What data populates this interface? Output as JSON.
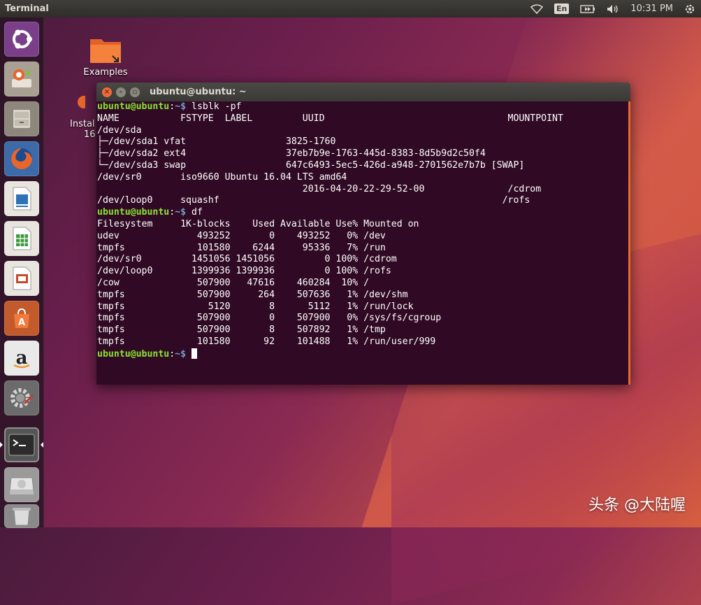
{
  "panel": {
    "app_title": "Terminal",
    "language": "En",
    "clock": "10:31 PM"
  },
  "launcher": {
    "items": [
      {
        "name": "dash-home",
        "icon": "ubuntu-logo-icon",
        "color": "#6f3a7c"
      },
      {
        "name": "install-ubuntu",
        "icon": "installer-icon",
        "color": "#c9c1b6"
      },
      {
        "name": "files",
        "icon": "file-cabinet-icon",
        "color": "#b8b1a5"
      },
      {
        "name": "firefox",
        "icon": "firefox-icon",
        "color": "#e8662c"
      },
      {
        "name": "writer",
        "icon": "writer-icon",
        "color": "#2e72b8"
      },
      {
        "name": "calc",
        "icon": "calc-icon",
        "color": "#3c9a3c"
      },
      {
        "name": "impress",
        "icon": "impress-icon",
        "color": "#c64a2a"
      },
      {
        "name": "software",
        "icon": "shopping-bag-icon",
        "color": "#e8672c"
      },
      {
        "name": "amazon",
        "icon": "amazon-icon",
        "color": "#e8e8e8"
      },
      {
        "name": "settings",
        "icon": "settings-gear-icon",
        "color": "#8a8a8a"
      },
      {
        "name": "terminal",
        "icon": "terminal-icon",
        "color": "#2a2a2a"
      },
      {
        "name": "disk",
        "icon": "disk-drive-icon",
        "color": "#c8c8c8"
      },
      {
        "name": "trash",
        "icon": "trash-icon",
        "color": "#b0b0b0"
      }
    ]
  },
  "desktop": {
    "examples_label": "Examples",
    "install_label_1": "Instal",
    "install_label_2": "16."
  },
  "terminal": {
    "title": "ubuntu@ubuntu: ~",
    "prompt_user": "ubuntu@ubuntu",
    "prompt_sep": ":",
    "prompt_path": "~$",
    "lines": [
      {
        "type": "prompt",
        "cmd": " lsblk -pf"
      },
      {
        "type": "out",
        "text": "NAME           FSTYPE  LABEL         UUID                                 MOUNTPOINT"
      },
      {
        "type": "out",
        "text": "/dev/sda"
      },
      {
        "type": "out",
        "text": "├─/dev/sda1 vfat                  3825-1760"
      },
      {
        "type": "out",
        "text": "├─/dev/sda2 ext4                  37eb7b9e-1763-445d-8383-8d5b9d2c50f4"
      },
      {
        "type": "out",
        "text": "└─/dev/sda3 swap                  647c6493-5ec5-426d-a948-2701562e7b7b [SWAP]"
      },
      {
        "type": "out",
        "text": "/dev/sr0       iso9660 Ubuntu 16.04 LTS amd64"
      },
      {
        "type": "out",
        "text": "                                     2016-04-20-22-29-52-00               /cdrom"
      },
      {
        "type": "out",
        "text": "/dev/loop0     squashf                                                   /rofs"
      },
      {
        "type": "prompt",
        "cmd": " df"
      },
      {
        "type": "out",
        "text": "Filesystem     1K-blocks    Used Available Use% Mounted on"
      },
      {
        "type": "out",
        "text": "udev              493252       0    493252   0% /dev"
      },
      {
        "type": "out",
        "text": "tmpfs             101580    6244     95336   7% /run"
      },
      {
        "type": "out",
        "text": "/dev/sr0         1451056 1451056         0 100% /cdrom"
      },
      {
        "type": "out",
        "text": "/dev/loop0       1399936 1399936         0 100% /rofs"
      },
      {
        "type": "out",
        "text": "/cow              507900   47616    460284  10% /"
      },
      {
        "type": "out",
        "text": "tmpfs             507900     264    507636   1% /dev/shm"
      },
      {
        "type": "out",
        "text": "tmpfs               5120       8      5112   1% /run/lock"
      },
      {
        "type": "out",
        "text": "tmpfs             507900       0    507900   0% /sys/fs/cgroup"
      },
      {
        "type": "out",
        "text": "tmpfs             507900       8    507892   1% /tmp"
      },
      {
        "type": "out",
        "text": "tmpfs             101580      92    101488   1% /run/user/999"
      },
      {
        "type": "prompt",
        "cmd": " ",
        "cursor": true
      }
    ]
  },
  "watermark": "头条 @大陆喔"
}
